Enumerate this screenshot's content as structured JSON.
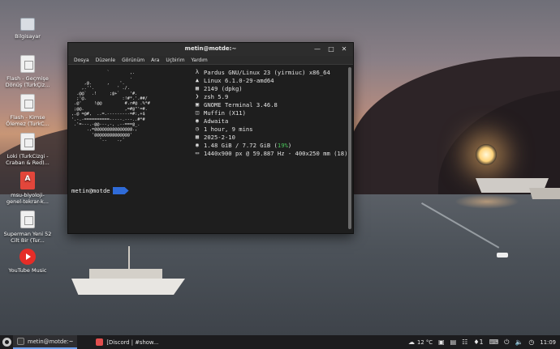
{
  "desktop": {
    "icons": [
      {
        "label": "Bilgisayar",
        "icon": "computer-icon"
      },
      {
        "label": "Flash - Geçmişe Dönüş (TurkÇiz...",
        "icon": "document-icon"
      },
      {
        "label": "Flash - Kimse Ölemez (TurkC...",
        "icon": "document-icon"
      },
      {
        "label": "Loki (TurkCizgi - Craban & Red)...",
        "icon": "document-icon"
      },
      {
        "label": "msu-biyoloji-genel-tekrar-k...",
        "icon": "pdf-icon"
      },
      {
        "label": "Superman Yeni 52 Cilt Bir (Tur...",
        "icon": "document-icon"
      },
      {
        "label": "YouTube Music",
        "icon": "youtube-music-icon"
      }
    ]
  },
  "terminal": {
    "title": "metin@motde:~",
    "menu": [
      "Dosya",
      "Düzenle",
      "Görünüm",
      "Ara",
      "Uçbirim",
      "Yardım"
    ],
    "ascii_logo": "              `        ,.\n                       .\n     ,@.      ,    '.\n    ,.''.         ' ./.\n  .@@`  .!     ;@+`    '#.\n  ;'@.              :!#*.'.##/\n .@'     !@@         #.r#@ .%*#\n ;@@.                ,=#@\"'=#.\n,.@ =@#,  ..=.---------=#:,+$\n'.-.-==========-----.---..#*#\n .'=---.-@@---,-, .--===@_.\n      .,=@@@@@@@@@@@@@@@.,\n        '@@@@@@@@@@@@@@'\n           '..    .,'",
    "info": [
      {
        "glyph": "pardus-icon",
        "text": "Pardus GNU/Linux 23 (yirmiuc) x86_64"
      },
      {
        "glyph": "linux-icon",
        "text": "Linux 6.1.0-29-amd64"
      },
      {
        "glyph": "package-icon",
        "text": "2149 (dpkg)"
      },
      {
        "glyph": "shell-icon",
        "text": "zsh 5.9"
      },
      {
        "glyph": "terminal-icon",
        "text": "GNOME Terminal 3.46.8"
      },
      {
        "glyph": "window-manager-icon",
        "text": "Muffin (X11)"
      },
      {
        "glyph": "theme-icon",
        "text": "Adwaita"
      },
      {
        "glyph": "uptime-icon",
        "text": "1 hour, 9 mins"
      },
      {
        "glyph": "calendar-icon",
        "text": "2025-2-10"
      },
      {
        "glyph": "memory-icon",
        "text_before": "1.48 GiB / 7.72 GiB (",
        "text_pct": "19%",
        "text_after": ")"
      },
      {
        "glyph": "display-icon",
        "text": "1440x900 px @ 59.887 Hz - 400x250 mm (18)"
      }
    ],
    "prompt_user": "metin@motde"
  },
  "taskbar": {
    "tasks": [
      {
        "label": "metin@motde:~",
        "active": true
      },
      {
        "label": "[Discord | #show...",
        "active": false
      }
    ],
    "weather": "12 °C",
    "notification_count": "1",
    "clock": "11:09"
  },
  "colors": {
    "terminal_bg": "#1e1e1e",
    "prompt_arrow": "#2f6bd8",
    "memory_pct": "#49c35a",
    "taskbar_bg": "#1c1c1e"
  }
}
